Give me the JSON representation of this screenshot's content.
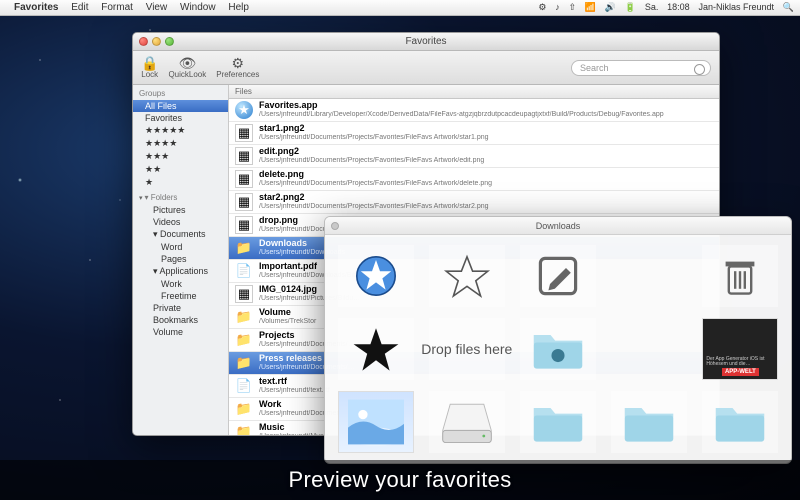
{
  "menubar": {
    "app": "Favorites",
    "items": [
      "Edit",
      "Format",
      "View",
      "Window",
      "Help"
    ],
    "status": {
      "day": "Sa.",
      "time": "18:08",
      "user": "Jan-Niklas Freundt"
    }
  },
  "window": {
    "title": "Favorites",
    "toolbar": {
      "lock": "Lock",
      "quicklook": "QuickLook",
      "preferences": "Preferences",
      "search_placeholder": "Search"
    },
    "sidebar": {
      "header1": "Groups",
      "groups": [
        {
          "label": "All Files",
          "selected": true
        },
        {
          "label": "Favorites"
        },
        {
          "label": "★★★★★"
        },
        {
          "label": "★★★★"
        },
        {
          "label": "★★★"
        },
        {
          "label": "★★"
        },
        {
          "label": "★"
        }
      ],
      "header2": "Folders",
      "folders": [
        {
          "label": "Pictures"
        },
        {
          "label": "Videos"
        },
        {
          "label": "Documents",
          "open": true,
          "children": [
            {
              "label": "Word"
            },
            {
              "label": "Pages"
            }
          ]
        },
        {
          "label": "Applications",
          "open": true,
          "children": [
            {
              "label": "Work"
            },
            {
              "label": "Freetime"
            }
          ]
        },
        {
          "label": "Private"
        },
        {
          "label": "Bookmarks"
        },
        {
          "label": "Volume"
        }
      ]
    },
    "files_header": "Files",
    "files": [
      {
        "icon": "app",
        "name": "Favorites.app",
        "path": "/Users/jnfreundt/Library/Developer/Xcode/DerivedData/FileFavs-atgzjqbrzdutpcacdeupagtjxtxf/Build/Products/Debug/Favorites.app"
      },
      {
        "icon": "img",
        "name": "star1.png2",
        "path": "/Users/jnfreundt/Documents/Projects/Favorites/FileFavs Artwork/star1.png"
      },
      {
        "icon": "img",
        "name": "edit.png2",
        "path": "/Users/jnfreundt/Documents/Projects/Favorites/FileFavs Artwork/edit.png"
      },
      {
        "icon": "img",
        "name": "delete.png",
        "path": "/Users/jnfreundt/Documents/Projects/Favorites/FileFavs Artwork/delete.png"
      },
      {
        "icon": "img",
        "name": "star2.png2",
        "path": "/Users/jnfreundt/Documents/Projects/Favorites/FileFavs Artwork/star2.png"
      },
      {
        "icon": "img",
        "name": "drop.png",
        "path": "/Users/jnfreundt/Documents/Projects/Favorites/FileFavs Artwork/drop.png"
      },
      {
        "icon": "folder",
        "name": "Downloads",
        "path": "/Users/jnfreundt/Downloads",
        "selected": true
      },
      {
        "icon": "doc",
        "name": "Important.pdf",
        "path": "/Users/jnfreundt/Downloads/Bibli…"
      },
      {
        "icon": "img",
        "name": "IMG_0124.jpg",
        "path": "/Users/jnfreundt/Pictures/Bildu…"
      },
      {
        "icon": "folder",
        "name": "Volume",
        "path": "/Volumes/TrekStor"
      },
      {
        "icon": "folder",
        "name": "Projects",
        "path": "/Users/jnfreundt/Documents/…"
      },
      {
        "icon": "folder",
        "name": "Press releases",
        "path": "/Users/jnfreundt/Documents/…",
        "selected": true
      },
      {
        "icon": "doc",
        "name": "text.rtf",
        "path": "/Users/jnfreundt/text.rtf"
      },
      {
        "icon": "folder",
        "name": "Work",
        "path": "/Users/jnfreundt/Documents/…"
      },
      {
        "icon": "folder",
        "name": "Music",
        "path": "/Users/jnfreundt/Music"
      }
    ]
  },
  "preview": {
    "title": "Downloads",
    "drop_label": "Drop files here",
    "appwelt_label": "APP-WELT"
  },
  "caption": "Preview your favorites"
}
